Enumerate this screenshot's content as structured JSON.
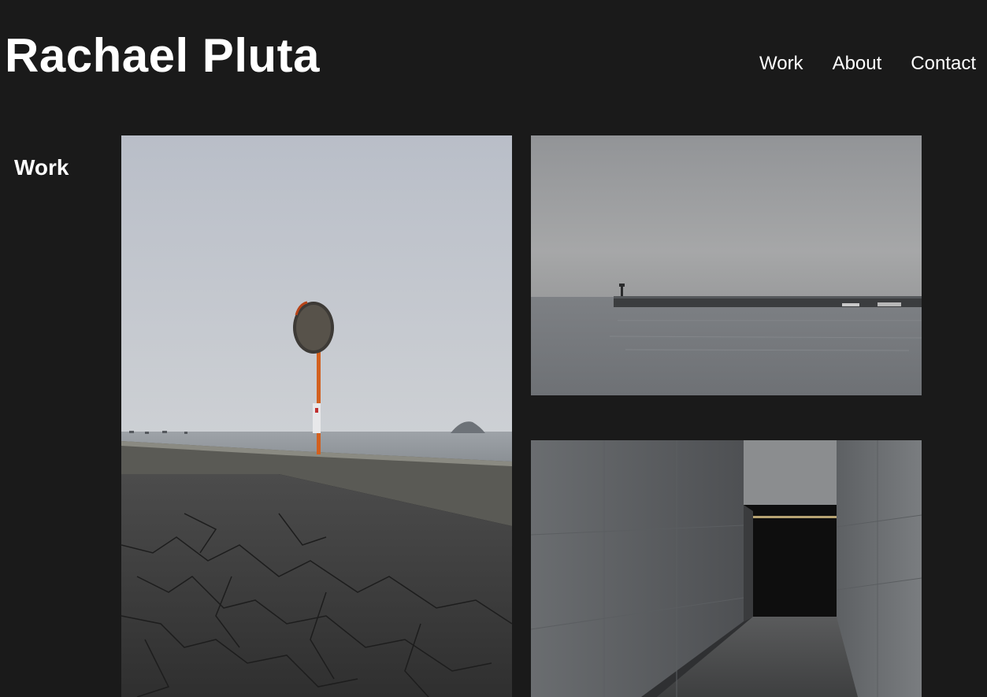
{
  "header": {
    "title": "Rachael Pluta"
  },
  "nav": {
    "items": [
      {
        "label": "Work"
      },
      {
        "label": "About"
      },
      {
        "label": "Contact"
      }
    ]
  },
  "section": {
    "heading": "Work"
  },
  "gallery": {
    "photos": [
      {
        "subject": "convex traffic mirror on a pole by a seawall, overcast sea"
      },
      {
        "subject": "breakwater pier over calm grey sea"
      },
      {
        "subject": "concrete corridor leading into a dark opening"
      }
    ]
  },
  "colors": {
    "background": "#1a1a1a",
    "text": "#ffffff"
  }
}
